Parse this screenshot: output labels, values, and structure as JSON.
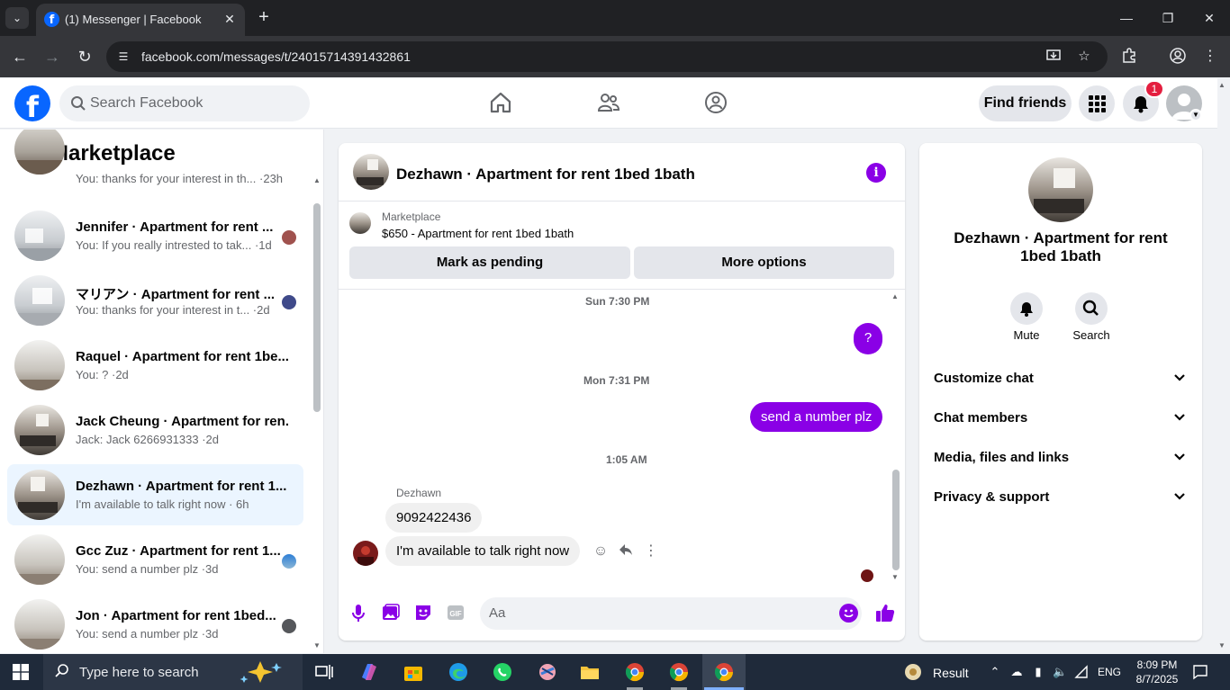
{
  "browser": {
    "tab_title": "(1) Messenger | Facebook",
    "url": "facebook.com/messages/t/24015714391432861"
  },
  "header": {
    "search_placeholder": "Search Facebook",
    "find_friends_label": "Find friends",
    "notification_count": "1"
  },
  "sidebar": {
    "title": "Marketplace",
    "threads": [
      {
        "name": "",
        "preview": "You: thanks for your interest in th... ·23h",
        "photo": "room"
      },
      {
        "name": "Jennifer · Apartment for rent ...",
        "preview": "You: If you really intrested to tak... ·1d",
        "photo": "bright"
      },
      {
        "name": "マリアン · Apartment for rent ...",
        "preview": "You: thanks for your interest in t... ·2d",
        "photo": "bright"
      },
      {
        "name": "Raquel · Apartment for rent 1be...",
        "preview": "You: ? ·2d",
        "photo": "empty"
      },
      {
        "name": "Jack Cheung · Apartment for ren...",
        "preview": "Jack: Jack 6266931333 ·2d",
        "photo": "living"
      },
      {
        "name": "Dezhawn · Apartment for rent 1...",
        "preview": "I'm available to talk right now · 6h",
        "photo": "living"
      },
      {
        "name": "Gcc Zuz · Apartment for rent 1...",
        "preview": "You: send a number plz ·3d",
        "photo": "empty"
      },
      {
        "name": "Jon · Apartment for rent 1bed...",
        "preview": "You: send a number plz ·3d",
        "photo": "empty"
      }
    ]
  },
  "chat": {
    "title": "Dezhawn · Apartment for rent 1bed 1bath",
    "listing_source": "Marketplace",
    "listing_title": "$650 - Apartment for rent 1bed 1bath",
    "mark_pending_label": "Mark as pending",
    "more_options_label": "More options",
    "timestamps": [
      "Sun 7:30 PM",
      "Mon 7:31 PM",
      "1:05 AM"
    ],
    "outgoing": [
      "?",
      "send a number plz"
    ],
    "sender_name": "Dezhawn",
    "incoming": [
      "9092422436",
      "I'm available to talk right now"
    ],
    "composer_placeholder": "Aa"
  },
  "info_panel": {
    "name": "Dezhawn · Apartment for rent 1bed 1bath",
    "mute_label": "Mute",
    "search_label": "Search",
    "sections": [
      "Customize chat",
      "Chat members",
      "Media, files and links",
      "Privacy & support"
    ]
  },
  "taskbar": {
    "search_placeholder": "Type here to search",
    "widget_label": "Result",
    "language": "ENG",
    "time": "8:09 PM",
    "date": "8/7/2025"
  },
  "colors": {
    "facebook_blue": "#0866ff",
    "messenger_purple": "#8a00e6",
    "active_thread": "#ebf5ff"
  }
}
